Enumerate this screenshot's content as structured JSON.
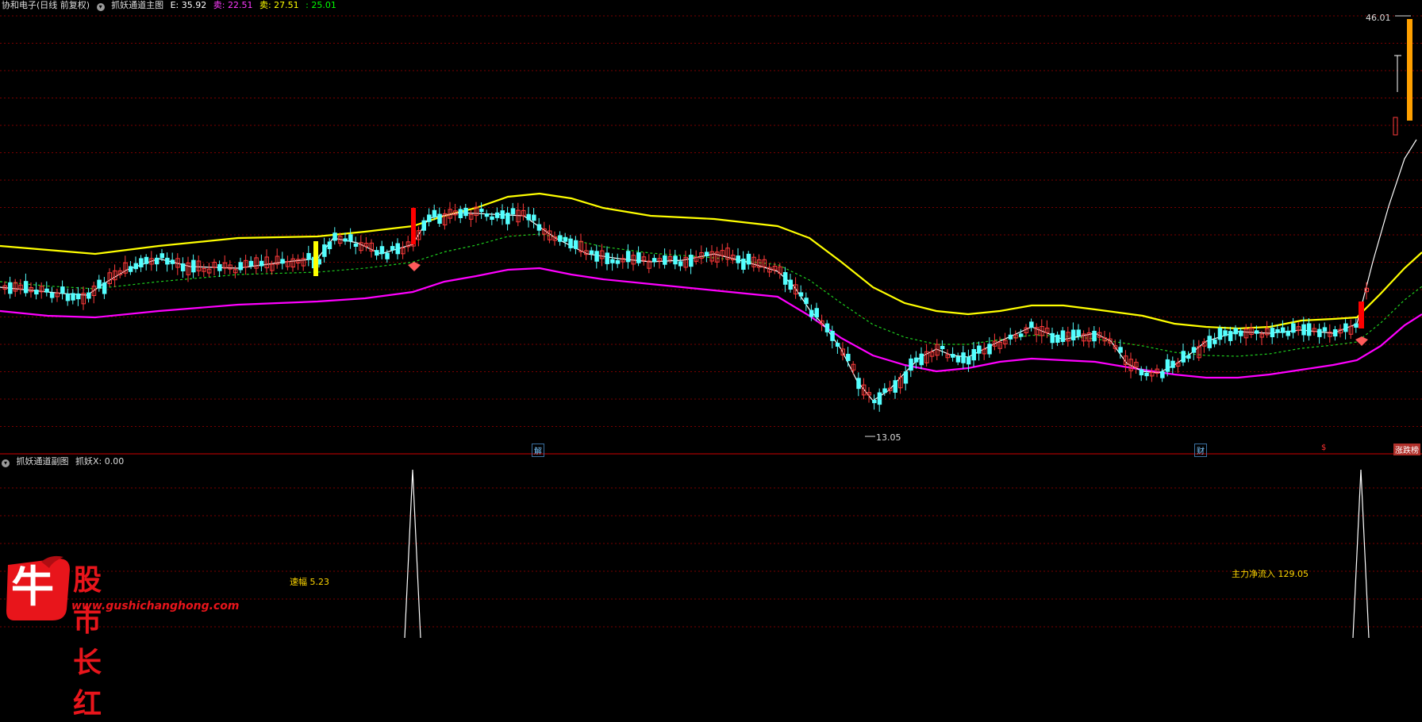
{
  "header_main": {
    "stock_name": "协和电子(日线 前复权)",
    "indicator_name": "抓妖通道主图",
    "e_label": "E: 35.92",
    "sell1_label": "卖: 22.51",
    "sell2_label": "卖: 27.51",
    "extra_value": ": 25.01",
    "icon": "settings-circle-icon"
  },
  "header_sub": {
    "indicator_name": "抓妖通道副图",
    "value_label": "抓妖X: 0.00",
    "icon": "settings-circle-icon"
  },
  "annotations": {
    "high_price": "46.01",
    "low_price": "13.05",
    "speed_label": "速幅 5.23",
    "flow_label": "主力净流入 129.05"
  },
  "event_markers": {
    "m1": "解",
    "m2": "财",
    "m3": "$",
    "m4": "涨跌榜"
  },
  "watermark": {
    "logo_char": "牛",
    "title": "股市长红",
    "url": "www.gushichanghong.com"
  },
  "colors": {
    "background": "#000000",
    "up_candle": "#ff3b3b",
    "down_candle": "#54ffff",
    "upper_band": "#ffff00",
    "lower_band": "#ff00ff",
    "mid_band": "#1ecf1e",
    "price_line": "#ffffff",
    "grid": "#7a0000",
    "signal_red": "#ff0000",
    "signal_yellow": "#ffff00",
    "signal_orange": "#ffa000"
  },
  "chart_data": {
    "type": "candlestick",
    "price_range": [
      13.05,
      46.01
    ],
    "high": 46.01,
    "low": 13.05,
    "series": [
      {
        "name": "抓妖X",
        "values": [
          0,
          0,
          0,
          0
        ]
      }
    ]
  }
}
